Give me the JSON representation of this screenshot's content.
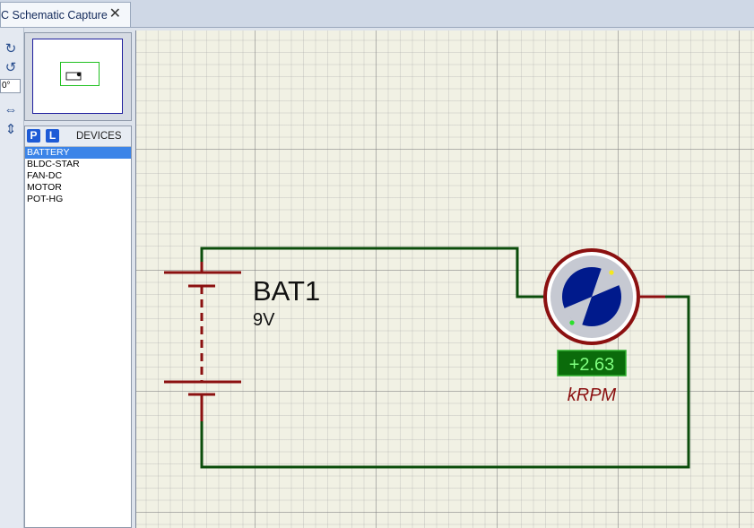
{
  "tab": {
    "title": "C Schematic Capture",
    "close_label": "✕"
  },
  "toolstrip": {
    "angle_value": "0°"
  },
  "devices": {
    "p_label": "P",
    "l_label": "L",
    "title": "DEVICES",
    "items": [
      "BATTERY",
      "BLDC-STAR",
      "FAN-DC",
      "MOTOR",
      "POT-HG"
    ],
    "selected": "BATTERY"
  },
  "schematic": {
    "battery_ref": "BAT1",
    "battery_value": "9V",
    "motor_readout": "+2.63",
    "motor_unit": "kRPM"
  },
  "colors": {
    "wire": "#0b4d0b",
    "component": "#8b1010",
    "motor_body": "#001a8c",
    "readout_bg": "#0b6b0b",
    "readout_text": "#80ff80",
    "selection": "#3b84e8"
  }
}
